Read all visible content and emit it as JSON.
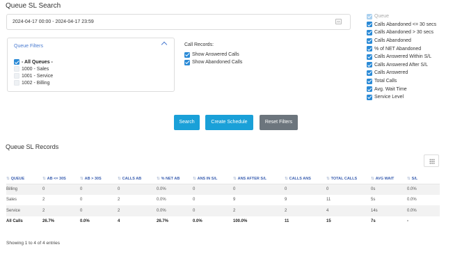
{
  "page": {
    "title": "Queue SL Search"
  },
  "date_range": {
    "value": "2024-04-17 00:00 - 2024-04-17 23:59"
  },
  "queue_filters": {
    "heading": "Queue Filters",
    "items": [
      {
        "label": "- All Queues -",
        "checked": true
      },
      {
        "label": "1000 - Sales",
        "checked": false
      },
      {
        "label": "1001 - Service",
        "checked": false
      },
      {
        "label": "1002 - Billing",
        "checked": false
      }
    ]
  },
  "call_records": {
    "title": "Call Records:",
    "items": [
      {
        "label": "Show Answered Calls",
        "checked": true
      },
      {
        "label": "Show Abandoned Calls",
        "checked": true
      }
    ]
  },
  "columns": [
    {
      "label": "Queue",
      "checked": true,
      "disabled": true
    },
    {
      "label": "Calls Abandoned <= 30 secs",
      "checked": true
    },
    {
      "label": "Calls Abandoned > 30 secs",
      "checked": true
    },
    {
      "label": "Calls Abandoned",
      "checked": true
    },
    {
      "label": "% of NET Abandoned",
      "checked": true
    },
    {
      "label": "Calls Answered Within S/L",
      "checked": true
    },
    {
      "label": "Calls Answered After S/L",
      "checked": true
    },
    {
      "label": "Calls Answered",
      "checked": true
    },
    {
      "label": "Total Calls",
      "checked": true
    },
    {
      "label": "Avg. Wait Time",
      "checked": true
    },
    {
      "label": "Service Level",
      "checked": true
    }
  ],
  "buttons": {
    "search": "Search",
    "create_schedule": "Create Schedule",
    "reset": "Reset Filters"
  },
  "records": {
    "title": "Queue SL Records",
    "headers": [
      "QUEUE",
      "AB <= 30S",
      "AB > 30S",
      "CALLS AB",
      "% NET AB",
      "ANS IN S/L",
      "ANS AFTER S/L",
      "CALLS ANS",
      "TOTAL CALLS",
      "AVG WAIT",
      "S/L"
    ],
    "rows": [
      [
        "Billing",
        "0",
        "0",
        "0",
        "0.0%",
        "0",
        "0",
        "0",
        "0",
        "0s",
        "0.0%"
      ],
      [
        "Sales",
        "2",
        "0",
        "2",
        "0.0%",
        "0",
        "9",
        "9",
        "11",
        "5s",
        "0.0%"
      ],
      [
        "Service",
        "2",
        "0",
        "2",
        "0.0%",
        "0",
        "2",
        "2",
        "4",
        "14s",
        "0.0%"
      ]
    ],
    "total_row": [
      "All Calls",
      "26.7%",
      "0.0%",
      "4",
      "26.7%",
      "0.0%",
      "100.0%",
      "11",
      "15",
      "7s",
      "-"
    ],
    "showing": "Showing 1 to 4 of 4 entries"
  },
  "colors": {
    "primary": "#1aa0d8",
    "secondary": "#6c757d",
    "checkbox": "#2a8ad6",
    "header_text": "#3b5fb0"
  },
  "icons": {
    "calendar": "calendar-icon",
    "chevron": "chevron-up-icon",
    "grid": "grid-icon",
    "sort": "sort-icon"
  }
}
